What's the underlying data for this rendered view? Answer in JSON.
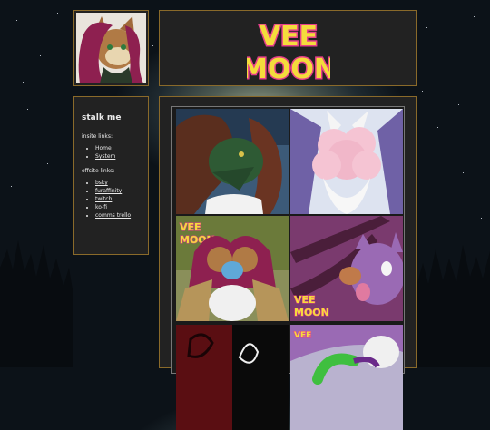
{
  "sidebar": {
    "title": "stalk me",
    "insite_label": "insite links:",
    "insite_links": [
      "Home",
      "System"
    ],
    "offsite_label": "offsite links:",
    "offsite_links": [
      "bsky",
      "furaffinity",
      "twitch",
      "ko-fi",
      "comms trello"
    ]
  },
  "logo": {
    "line1": "VEE",
    "line2": "MOON"
  },
  "colors": {
    "panel_bg": "#222222",
    "panel_border": "#8a6a2a",
    "logo_yellow": "#f4dc3c",
    "logo_pink": "#e8408a"
  },
  "gallery": {
    "images": [
      "green-dragon-with-brown-hair-art",
      "pink-fluffy-creature-art",
      "vee-moon-group-character-art",
      "purple-character-with-tongue-out-art",
      "red-dark-abstract-art",
      "purple-character-green-tentacle-art"
    ]
  }
}
